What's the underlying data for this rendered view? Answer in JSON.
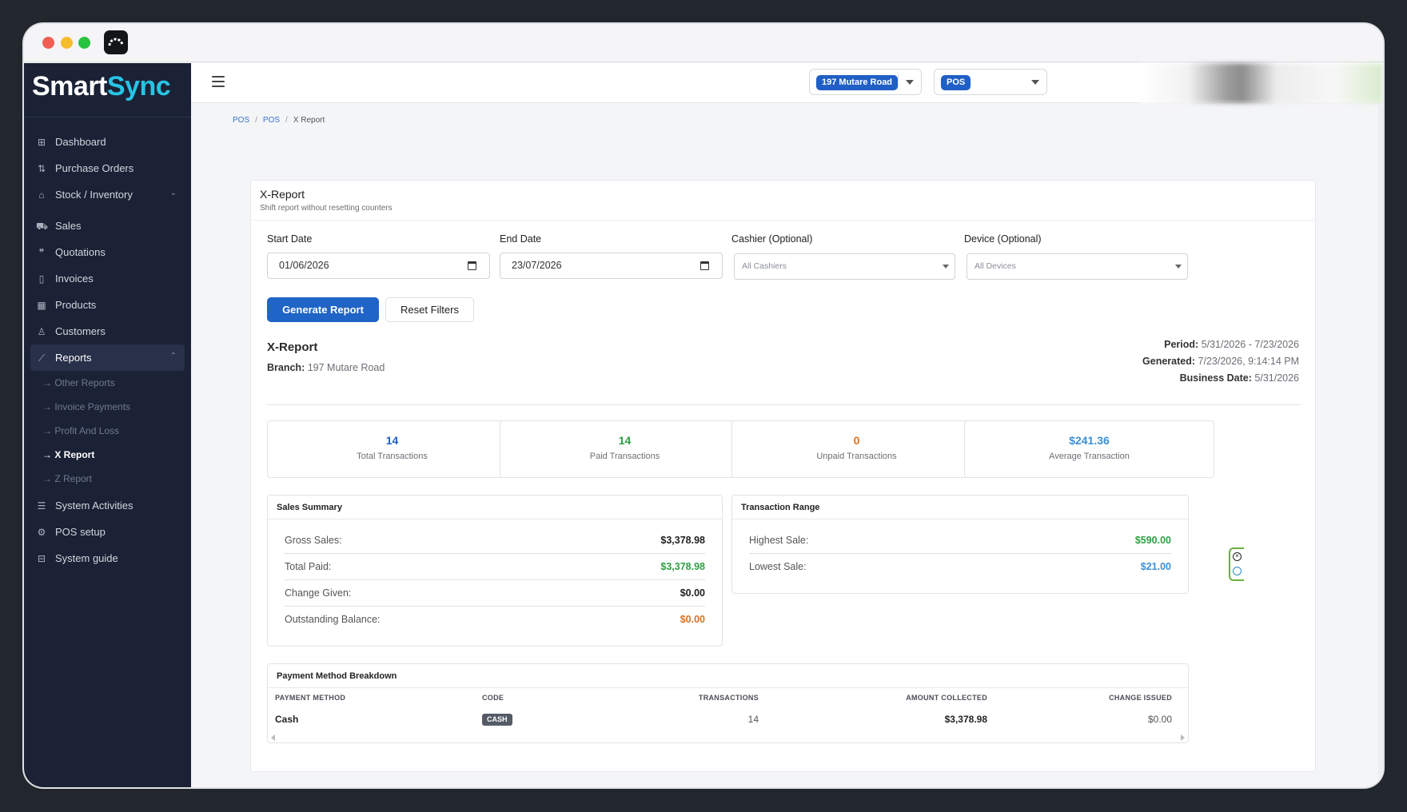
{
  "app": {
    "logo_part1": "Smart",
    "logo_part2": "Sync"
  },
  "sidebar": {
    "items": [
      {
        "label": "Dashboard",
        "icon": "grid-icon"
      },
      {
        "label": "Purchase Orders",
        "icon": "sort-icon"
      },
      {
        "label": "Stock / Inventory",
        "icon": "warehouse-icon"
      },
      {
        "label": "Sales",
        "icon": "cart-icon"
      },
      {
        "label": "Quotations",
        "icon": "quote-icon"
      },
      {
        "label": "Invoices",
        "icon": "invoice-icon"
      },
      {
        "label": "Products",
        "icon": "table-icon"
      },
      {
        "label": "Customers",
        "icon": "user-icon"
      },
      {
        "label": "Reports",
        "icon": "chart-line-icon"
      },
      {
        "label": "System Activities",
        "icon": "list-icon"
      },
      {
        "label": "POS setup",
        "icon": "settings-icon"
      },
      {
        "label": "System guide",
        "icon": "book-icon"
      }
    ],
    "report_subitems": [
      {
        "label": "→ Other Reports"
      },
      {
        "label": "→ Invoice Payments"
      },
      {
        "label": "→ Profit And Loss"
      },
      {
        "label": "→ X Report"
      },
      {
        "label": "→ Z Report"
      }
    ]
  },
  "topbar": {
    "branch": "197 Mutare Road",
    "mode": "POS"
  },
  "breadcrumb": [
    "POS",
    "POS",
    "X Report"
  ],
  "card": {
    "title": "X-Report",
    "subtitle": "Shift report without resetting counters"
  },
  "filters": {
    "start_label": "Start Date",
    "start_value": "01/06/2026",
    "end_label": "End Date",
    "end_value": "23/07/2026",
    "cashier_label": "Cashier (Optional)",
    "cashier_value": "All Cashiers",
    "device_label": "Device (Optional)",
    "device_value": "All Devices",
    "generate": "Generate Report",
    "reset": "Reset Filters"
  },
  "report": {
    "title": "X-Report",
    "branch_label": "Branch:",
    "branch_value": "197 Mutare Road",
    "period_label": "Period:",
    "period_value": "5/31/2026 - 7/23/2026",
    "generated_label": "Generated:",
    "generated_value": "7/23/2026, 9:14:14 PM",
    "business_label": "Business Date:",
    "business_value": "5/31/2026"
  },
  "stats": [
    {
      "value": "14",
      "label": "Total Transactions",
      "color": "#1f5fc6"
    },
    {
      "value": "14",
      "label": "Paid Transactions",
      "color": "#2ea043"
    },
    {
      "value": "0",
      "label": "Unpaid Transactions",
      "color": "#e0701a"
    },
    {
      "value": "$241.36",
      "label": "Average Transaction",
      "color": "#3b8fd4"
    }
  ],
  "sales_summary": {
    "title": "Sales Summary",
    "rows": [
      {
        "label": "Gross Sales:",
        "value": "$3,378.98",
        "color": "#222222"
      },
      {
        "label": "Total Paid:",
        "value": "$3,378.98",
        "color": "#2ea043"
      },
      {
        "label": "Change Given:",
        "value": "$0.00",
        "color": "#222222"
      },
      {
        "label": "Outstanding Balance:",
        "value": "$0.00",
        "color": "#e0701a"
      }
    ]
  },
  "transaction_range": {
    "title": "Transaction Range",
    "rows": [
      {
        "label": "Highest Sale:",
        "value": "$590.00",
        "color": "#2ea043"
      },
      {
        "label": "Lowest Sale:",
        "value": "$21.00",
        "color": "#3b8fd4"
      }
    ]
  },
  "payment_breakdown": {
    "title": "Payment Method Breakdown",
    "headers": [
      "PAYMENT METHOD",
      "CODE",
      "TRANSACTIONS",
      "AMOUNT COLLECTED",
      "CHANGE ISSUED"
    ],
    "rows": [
      {
        "method": "Cash",
        "code": "CASH",
        "transactions": "14",
        "amount": "$3,378.98",
        "change": "$0.00"
      }
    ]
  }
}
